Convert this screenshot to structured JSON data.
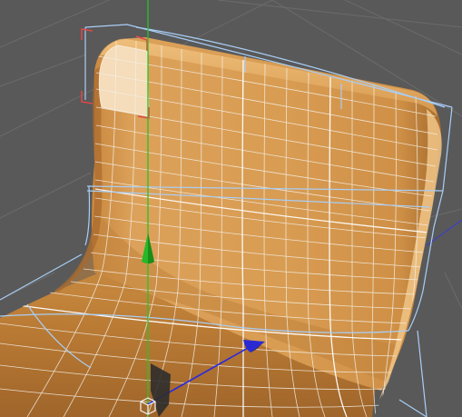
{
  "viewport": {
    "background_color": "#5a5a5a",
    "grid_color": "#6c6c6c",
    "mesh_fill_color": "#d79a4c",
    "mesh_shadow_color": "#8a5a25",
    "mesh_highlight_color": "#f2c486",
    "wireframe_color": "#e9eef8",
    "cage_color": "#a8ccf4",
    "selection_color": "#e34343",
    "selected_patch_color": "#f6dfbf"
  },
  "manipulator": {
    "y_axis_color": "#27c427",
    "z_axis_color": "#2a2ae0",
    "x_axis_color": "#27c427",
    "y_arrow_icon": "green-cone-arrow",
    "z_arrow_icon": "blue-cone-arrow",
    "pivot_icon": "cube-pivot-icon"
  },
  "object": {
    "type": "chair-seat-subdivision-mesh",
    "selection_state": "face-selected"
  }
}
